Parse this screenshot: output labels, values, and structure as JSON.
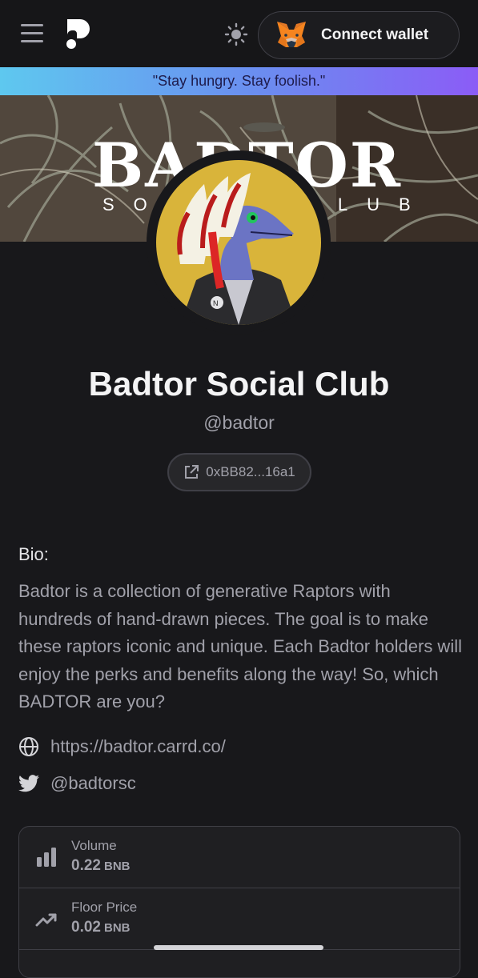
{
  "header": {
    "connect_label": "Connect wallet",
    "menu_icon": "hamburger-menu-icon",
    "logo_icon": "p-logo-icon",
    "theme_icon": "sun-icon",
    "wallet_icon": "metamask-fox-icon"
  },
  "quote": "\"Stay hungry. Stay foolish.\"",
  "banner": {
    "title": "BADTOR",
    "subtitle": "SOCIAL CLUB"
  },
  "profile": {
    "name": "Badtor Social Club",
    "handle": "@badtor",
    "address": "0xBB82...16a1"
  },
  "bio": {
    "heading": "Bio:",
    "text": "Badtor is a collection of generative Raptors with hundreds of hand-drawn pieces. The goal is to make these raptors iconic and unique. Each Badtor holders will enjoy the perks and benefits along the way! So, which BADTOR are you?"
  },
  "links": {
    "website": "https://badtor.carrd.co/",
    "twitter": "@badtorsc"
  },
  "stats": [
    {
      "label": "Volume",
      "value": "0.22",
      "unit": "BNB",
      "icon": "bar-chart-icon"
    },
    {
      "label": "Floor Price",
      "value": "0.02",
      "unit": "BNB",
      "icon": "trending-up-icon"
    }
  ],
  "colors": {
    "background": "#18181b",
    "quote_gradient_start": "#5ec8ef",
    "quote_gradient_end": "#8b5cf6",
    "avatar_bg": "#d9b43a",
    "raptor_skin": "#6b74c4"
  }
}
